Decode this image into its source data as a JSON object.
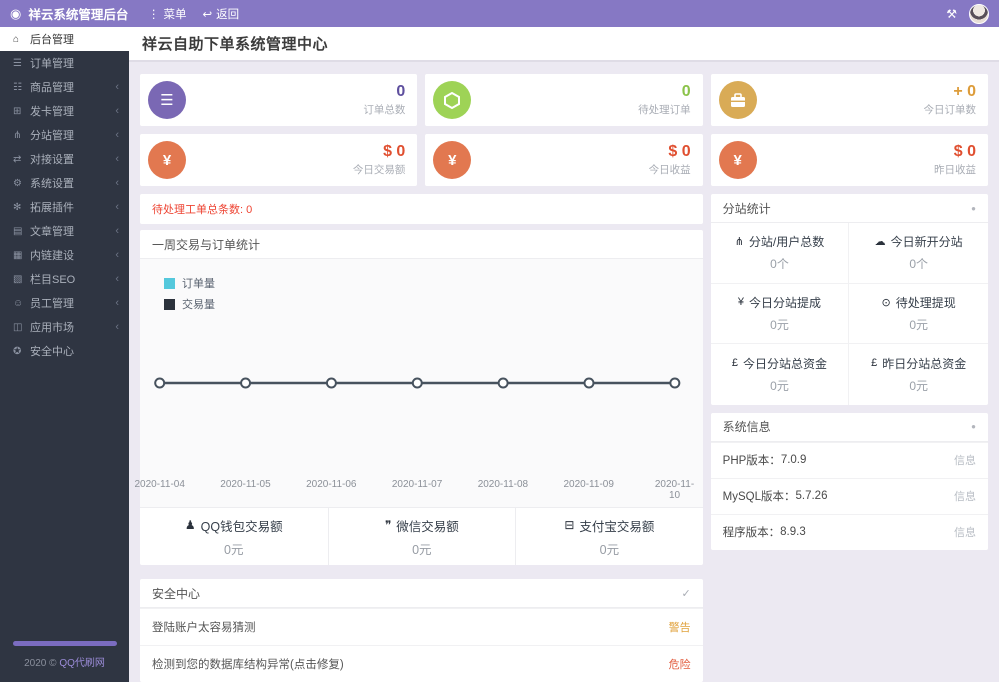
{
  "header": {
    "brand": "祥云系统管理后台",
    "menu_label": "菜单",
    "back_label": "返回"
  },
  "sidebar": {
    "items": [
      {
        "label": "后台管理",
        "glyph": "⌂",
        "active": true,
        "has_children": false
      },
      {
        "label": "订单管理",
        "glyph": "☰",
        "active": false,
        "has_children": false
      },
      {
        "label": "商品管理",
        "glyph": "☷",
        "active": false,
        "has_children": true
      },
      {
        "label": "发卡管理",
        "glyph": "⊞",
        "active": false,
        "has_children": true
      },
      {
        "label": "分站管理",
        "glyph": "⋔",
        "active": false,
        "has_children": true
      },
      {
        "label": "对接设置",
        "glyph": "⇄",
        "active": false,
        "has_children": true
      },
      {
        "label": "系统设置",
        "glyph": "⚙",
        "active": false,
        "has_children": true
      },
      {
        "label": "拓展插件",
        "glyph": "✻",
        "active": false,
        "has_children": true
      },
      {
        "label": "文章管理",
        "glyph": "▤",
        "active": false,
        "has_children": true
      },
      {
        "label": "内链建设",
        "glyph": "▦",
        "active": false,
        "has_children": true
      },
      {
        "label": "栏目SEO",
        "glyph": "▧",
        "active": false,
        "has_children": true
      },
      {
        "label": "员工管理",
        "glyph": "☺",
        "active": false,
        "has_children": true
      },
      {
        "label": "应用市场",
        "glyph": "◫",
        "active": false,
        "has_children": true
      },
      {
        "label": "安全中心",
        "glyph": "✪",
        "active": false,
        "has_children": false
      }
    ],
    "chevron": "‹",
    "footer_year": "2020 ©",
    "footer_link": "QQ代刷网"
  },
  "page": {
    "title": "祥云自助下单系统管理中心"
  },
  "stat_cards": [
    {
      "value": "0",
      "label": "订单总数",
      "value_color": "#5e4f9e",
      "icon_bg": "#7a68b4",
      "icon": "list-ol-icon",
      "glyph": "☰"
    },
    {
      "value": "0",
      "label": "待处理订单",
      "value_color": "#8bc34a",
      "icon_bg": "#9ed356",
      "icon": "hexagon-icon",
      "glyph": ""
    },
    {
      "value": "+ 0",
      "label": "今日订单数",
      "value_color": "#dd9c3a",
      "icon_bg": "#d9ab56",
      "icon": "briefcase-icon",
      "glyph": ""
    },
    {
      "value": "$ 0",
      "label": "今日交易额",
      "value_color": "#e04f30",
      "icon_bg": "#e27850",
      "icon": "yen-icon",
      "glyph": "¥"
    },
    {
      "value": "$ 0",
      "label": "今日收益",
      "value_color": "#e04f30",
      "icon_bg": "#e27850",
      "icon": "yen-icon",
      "glyph": "¥"
    },
    {
      "value": "$ 0",
      "label": "昨日收益",
      "value_color": "#e04f30",
      "icon_bg": "#e27850",
      "icon": "yen-icon",
      "glyph": "¥"
    }
  ],
  "notice": {
    "text": "待处理工单总条数:",
    "value": "0"
  },
  "chart_panel": {
    "title": "一周交易与订单统计"
  },
  "chart_data": {
    "type": "line",
    "x": [
      "2020-11-04",
      "2020-11-05",
      "2020-11-06",
      "2020-11-07",
      "2020-11-08",
      "2020-11-09",
      "2020-11-10"
    ],
    "series": [
      {
        "name": "订单量",
        "color": "#54c8dc",
        "values": [
          0,
          0,
          0,
          0,
          0,
          0,
          0
        ]
      },
      {
        "name": "交易量",
        "color": "#2b323c",
        "values": [
          0,
          0,
          0,
          0,
          0,
          0,
          0
        ]
      }
    ],
    "title": "一周交易与订单统计",
    "xlabel": "",
    "ylabel": "",
    "ylim": [
      0,
      1
    ],
    "grid": false,
    "legend_position": "top-left",
    "line_color": "#47525e",
    "marker": "open-circle"
  },
  "payments": [
    {
      "glyph": "♟",
      "icon": "qq-icon",
      "label": "QQ钱包交易额",
      "value": "0元"
    },
    {
      "glyph": "❞",
      "icon": "wechat-icon",
      "label": "微信交易额",
      "value": "0元"
    },
    {
      "glyph": "⊟",
      "icon": "alipay-icon",
      "label": "支付宝交易额",
      "value": "0元"
    }
  ],
  "security": {
    "title": "安全中心",
    "check": "✓",
    "items": [
      {
        "text": "登陆账户太容易猜测",
        "status": "警告",
        "level": "warning"
      },
      {
        "text": "检测到您的数据库结构异常(点击修复)",
        "status": "危险",
        "level": "danger"
      }
    ]
  },
  "branch_stats": {
    "title": "分站统计",
    "dot": "●",
    "cells": [
      {
        "glyph": "⋔",
        "icon": "sitemap-icon",
        "label": "分站/用户总数",
        "value": "0个"
      },
      {
        "glyph": "☁",
        "icon": "cloud-icon",
        "label": "今日新开分站",
        "value": "0个"
      },
      {
        "glyph": "¥",
        "icon": "yen-icon",
        "label": "今日分站提成",
        "value": "0元"
      },
      {
        "glyph": "⊙",
        "icon": "cash-icon",
        "label": "待处理提现",
        "value": "0元"
      },
      {
        "glyph": "£",
        "icon": "pound-icon",
        "label": "今日分站总资金",
        "value": "0元"
      },
      {
        "glyph": "£",
        "icon": "pound-icon",
        "label": "昨日分站总资金",
        "value": "0元"
      }
    ]
  },
  "system_info": {
    "title": "系统信息",
    "dot": "●",
    "rows": [
      {
        "label": "PHP版本：",
        "value": "7.0.9",
        "badge": "信息"
      },
      {
        "label": "MySQL版本：",
        "value": "5.7.26",
        "badge": "信息"
      },
      {
        "label": "程序版本：",
        "value": "8.9.3",
        "badge": "信息"
      }
    ]
  }
}
